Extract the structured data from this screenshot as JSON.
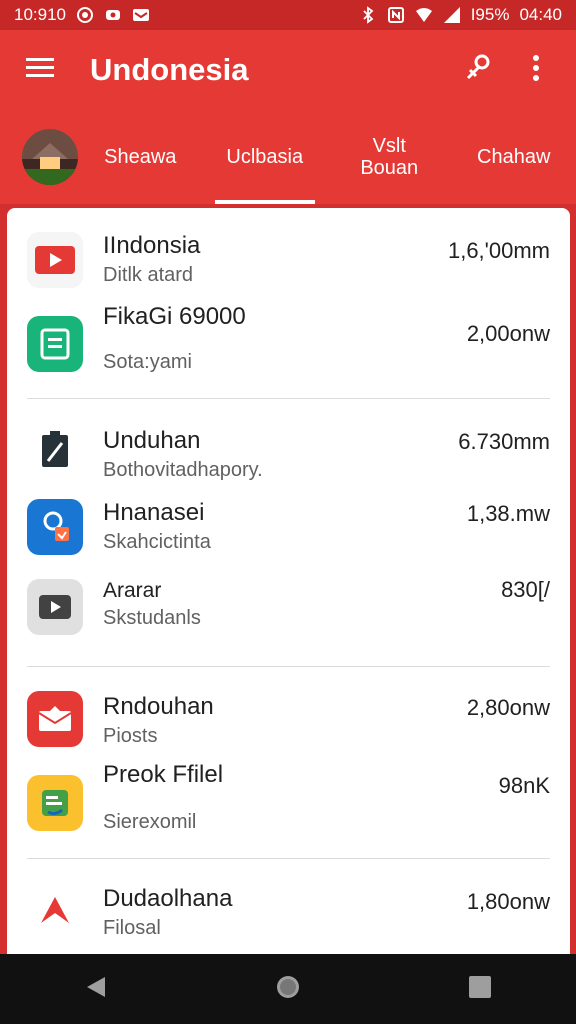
{
  "status": {
    "time_left": "10:910",
    "battery": "I95%",
    "time_right": "04:40"
  },
  "app_bar": {
    "title": "Undonesia",
    "icons": [
      "menu-icon",
      "share-icon",
      "more-vert-icon"
    ]
  },
  "tabs": [
    {
      "label": "Sheawa"
    },
    {
      "label": "Uclbasia",
      "active": true
    },
    {
      "label": "Vslt\nBouan"
    },
    {
      "label": "Chahaw"
    }
  ],
  "groups": [
    {
      "items": [
        {
          "name": "IIndonsia",
          "sub": "Ditlk atard",
          "value": "1,6,'00mm",
          "icon": "youtube-icon",
          "color": "#e53935"
        },
        {
          "name": "FikaGi 69000",
          "sub": "Sota:yami",
          "value": "2,00onw",
          "icon": "notes-icon",
          "color": "#19b47a"
        }
      ]
    },
    {
      "items": [
        {
          "name": "Unduhan",
          "sub": "Bothovitadhapory.",
          "value": "6.730mm",
          "icon": "clipboard-icon",
          "color": "#263238"
        },
        {
          "name": "Hnanasei",
          "sub": "Skahcictinta",
          "value": "1,38.mw",
          "icon": "photo-edit-icon",
          "color": "#1976d2"
        },
        {
          "name": "Ararar",
          "sub": "Skstudanls",
          "value": "830[/",
          "icon": "video-icon",
          "color": "#e0e0e0"
        }
      ]
    },
    {
      "items": [
        {
          "name": "Rndouhan",
          "sub": "Piosts",
          "value": "2,80onw",
          "icon": "mail-icon",
          "color": "#e53935"
        },
        {
          "name": "Preok Ffilel",
          "sub": "Sierexomil",
          "value": "98nK",
          "icon": "sticker-icon",
          "color": "#fbc02d"
        }
      ]
    },
    {
      "items": [
        {
          "name": "Dudaolhana",
          "sub": "Filosal",
          "value": "1,80onw",
          "icon": "arrow-logo-icon",
          "color": "#e53935"
        }
      ]
    }
  ],
  "nav": [
    "back-icon",
    "home-icon",
    "recents-icon"
  ]
}
